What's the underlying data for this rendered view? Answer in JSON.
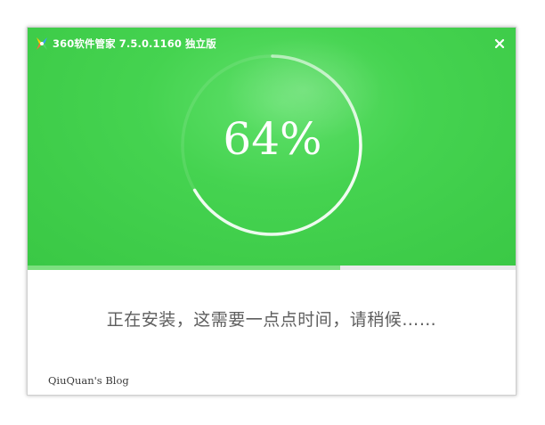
{
  "window": {
    "title": "360软件管家 7.5.0.1160 独立版",
    "icon": "app-logo-icon",
    "close_icon": "close-icon"
  },
  "progress": {
    "percent_label": "64%",
    "value": 0.64,
    "bar_fill_fraction": 0.64
  },
  "status": {
    "message": "正在安装，这需要一点点时间，请稍候……"
  },
  "watermark": {
    "text": "QiuQuan's Blog"
  },
  "colors": {
    "header_green": "#3fcd4a",
    "progress_fill": "#7ce07f",
    "progress_track": "#e8eaea",
    "status_text": "#5e5e5e"
  }
}
